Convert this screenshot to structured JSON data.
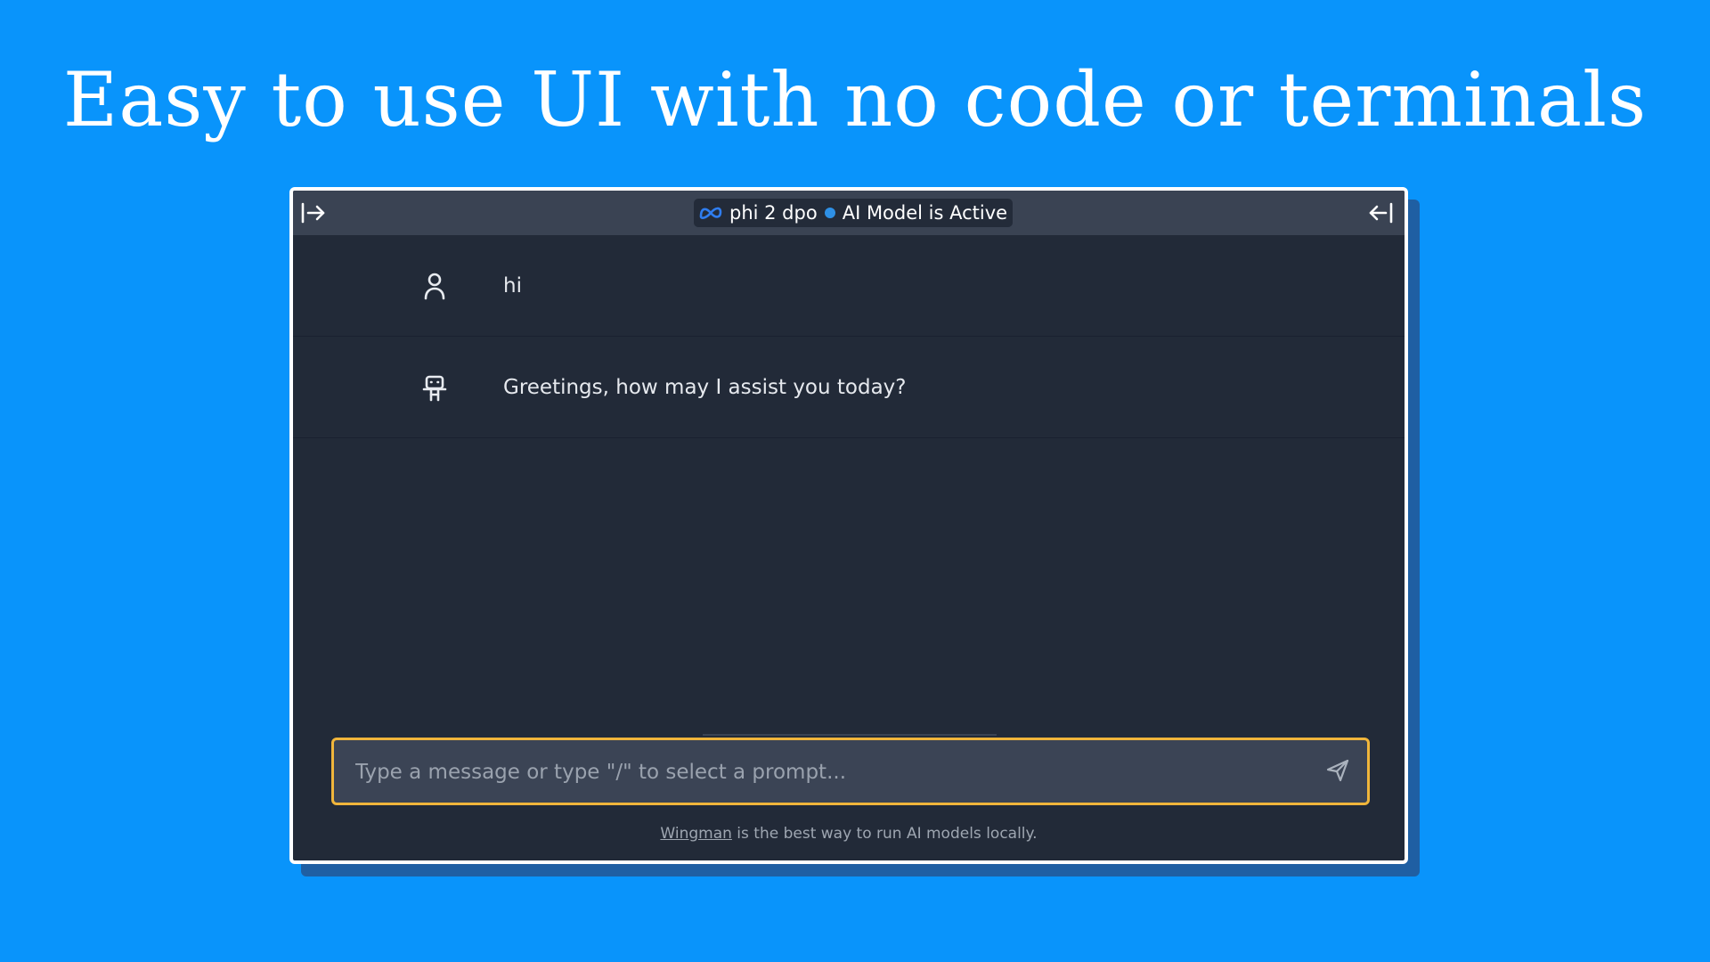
{
  "headline": "Easy to use UI with no code or terminals",
  "topbar": {
    "model_name": "phi 2 dpo",
    "status_text": "AI Model is Active",
    "status_color": "#2e90e6",
    "left_icon": "sidebar-expand-icon",
    "right_icon": "sidebar-collapse-icon",
    "model_icon": "meta-logo-icon"
  },
  "messages": [
    {
      "role": "user",
      "icon": "user-icon",
      "text": "hi"
    },
    {
      "role": "assistant",
      "icon": "robot-icon",
      "text": "Greetings, how may I assist you today?"
    }
  ],
  "composer": {
    "placeholder": "Type a message or type \"/\" to select a prompt...",
    "value": "",
    "send_icon": "send-icon",
    "border_color": "#f0b53b"
  },
  "footer": {
    "link_text": "Wingman",
    "suffix": " is the best way to run AI models locally."
  },
  "colors": {
    "background": "#0994fb",
    "window": "#222a38",
    "topbar": "#3a4353"
  }
}
